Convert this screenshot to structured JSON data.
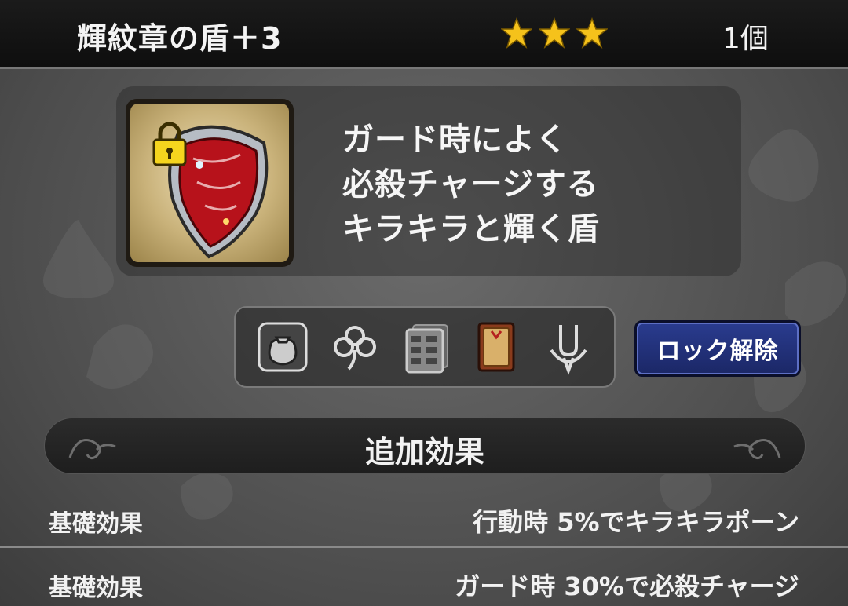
{
  "header": {
    "item_name": "輝紋章の盾＋3",
    "rarity_stars": 3,
    "count": "1個"
  },
  "item": {
    "icon": "shield-icon",
    "locked": true,
    "description_lines": [
      "ガード時によく",
      "必殺チャージする",
      "キラキラと輝く盾"
    ]
  },
  "actions": [
    {
      "name": "sell-bag-icon"
    },
    {
      "name": "clover-icon"
    },
    {
      "name": "storage-drawer-icon"
    },
    {
      "name": "book-icon"
    },
    {
      "name": "fork-tool-icon"
    }
  ],
  "lock_button": "ロック解除",
  "section_title": "追加効果",
  "effects": [
    {
      "label": "基礎効果",
      "value": "行動時  5%でキラキラポーン"
    },
    {
      "label": "基礎効果",
      "value": "ガード時  30%で必殺チャージ"
    }
  ],
  "colors": {
    "star": "#f5c21b",
    "lock_button": "#23327a",
    "icon_background": "#d2bc85"
  }
}
